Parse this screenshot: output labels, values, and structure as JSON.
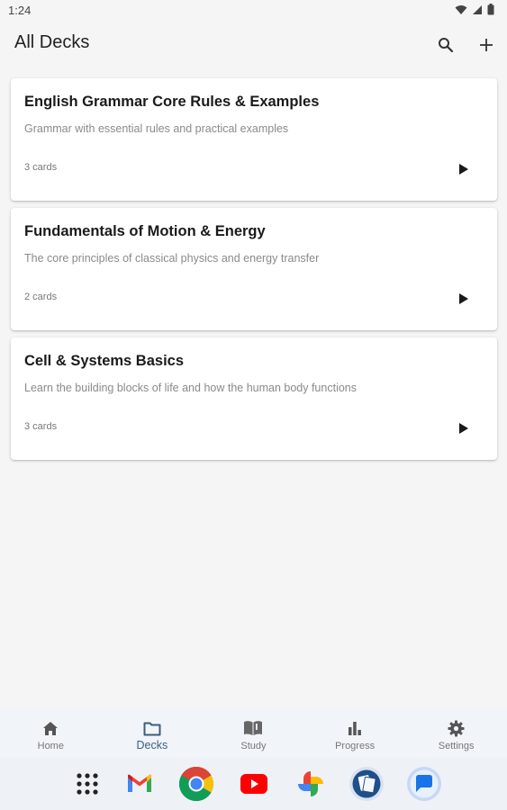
{
  "status_bar": {
    "time": "1:24"
  },
  "app_bar": {
    "title": "All Decks"
  },
  "decks": [
    {
      "title": "English Grammar Core Rules & Examples",
      "description": "Grammar with essential rules and practical examples",
      "count": "3 cards"
    },
    {
      "title": "Fundamentals of Motion & Energy",
      "description": "The core principles of classical physics and energy transfer",
      "count": "2 cards"
    },
    {
      "title": "Cell & Systems Basics",
      "description": "Learn the building blocks of life and how the human body functions",
      "count": "3 cards"
    }
  ],
  "bottom_nav": {
    "items": [
      {
        "label": "Home",
        "icon": "home-icon"
      },
      {
        "label": "Decks",
        "icon": "folder-icon",
        "active": true
      },
      {
        "label": "Study",
        "icon": "book-icon"
      },
      {
        "label": "Progress",
        "icon": "bar-chart-icon"
      },
      {
        "label": "Settings",
        "icon": "gear-icon"
      }
    ]
  },
  "dock": {
    "apps": [
      "app-drawer-icon",
      "gmail-icon",
      "chrome-icon",
      "youtube-icon",
      "photos-icon",
      "flashcards-app-icon",
      "messages-icon"
    ]
  },
  "colors": {
    "accent": "#3a5f7c",
    "background": "#f5f5f5",
    "card": "#ffffff",
    "nav_background": "#f1f4f9"
  }
}
